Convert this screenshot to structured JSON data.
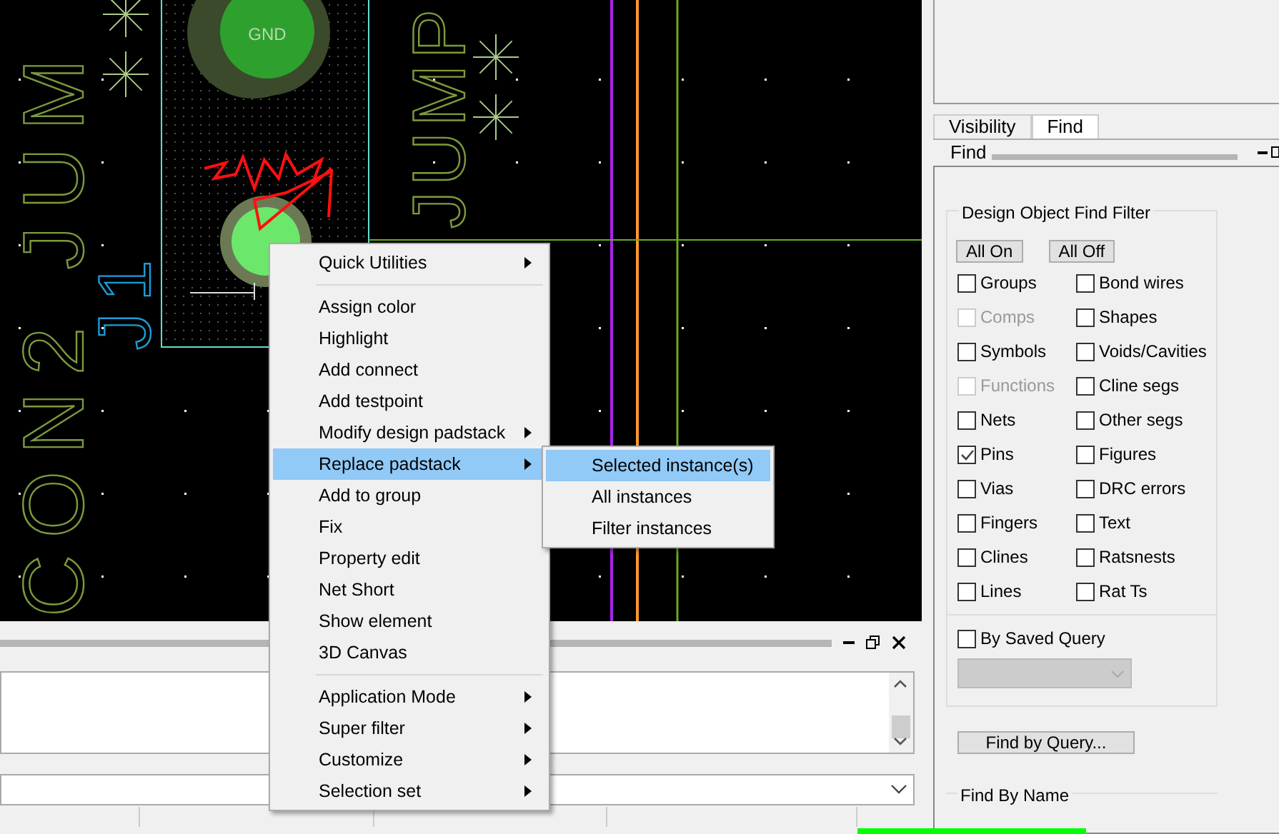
{
  "canvas": {
    "labels": [
      {
        "text": "CON2 JUM",
        "kind": "silk"
      },
      {
        "text": "J1",
        "kind": "refdes"
      },
      {
        "text": "JUMP",
        "kind": "silk"
      }
    ],
    "pad_label": "GND"
  },
  "context_menu": {
    "items": [
      {
        "kind": "item",
        "label": "Quick Utilities",
        "submenu": true,
        "selected": false
      },
      {
        "kind": "separator"
      },
      {
        "kind": "item",
        "label": "Assign color",
        "submenu": false,
        "selected": false
      },
      {
        "kind": "item",
        "label": "Highlight",
        "submenu": false,
        "selected": false
      },
      {
        "kind": "item",
        "label": "Add connect",
        "submenu": false,
        "selected": false
      },
      {
        "kind": "item",
        "label": "Add testpoint",
        "submenu": false,
        "selected": false
      },
      {
        "kind": "item",
        "label": "Modify design padstack",
        "submenu": true,
        "selected": false
      },
      {
        "kind": "item",
        "label": "Replace padstack",
        "submenu": true,
        "selected": true
      },
      {
        "kind": "item",
        "label": "Add to group",
        "submenu": false,
        "selected": false
      },
      {
        "kind": "item",
        "label": "Fix",
        "submenu": false,
        "selected": false
      },
      {
        "kind": "item",
        "label": "Property edit",
        "submenu": false,
        "selected": false
      },
      {
        "kind": "item",
        "label": "Net Short",
        "submenu": false,
        "selected": false
      },
      {
        "kind": "item",
        "label": "Show element",
        "submenu": false,
        "selected": false
      },
      {
        "kind": "item",
        "label": "3D Canvas",
        "submenu": false,
        "selected": false
      },
      {
        "kind": "separator"
      },
      {
        "kind": "item",
        "label": "Application Mode",
        "submenu": true,
        "selected": false
      },
      {
        "kind": "item",
        "label": "Super filter",
        "submenu": true,
        "selected": false
      },
      {
        "kind": "item",
        "label": "Customize",
        "submenu": true,
        "selected": false
      },
      {
        "kind": "item",
        "label": "Selection set",
        "submenu": true,
        "selected": false
      }
    ]
  },
  "submenu": {
    "items": [
      {
        "label": "Selected instance(s)",
        "selected": true
      },
      {
        "label": "All instances",
        "selected": false
      },
      {
        "label": "Filter instances",
        "selected": false
      }
    ]
  },
  "panel": {
    "tabs": [
      {
        "label": "Visibility",
        "selected": false
      },
      {
        "label": "Find",
        "selected": true
      }
    ],
    "header": "Find",
    "group": {
      "title": "Design Object Find Filter",
      "buttons": [
        "All On",
        "All Off"
      ],
      "checkboxes": [
        {
          "label": "Groups",
          "checked": false,
          "disabled": false
        },
        {
          "label": "Bond wires",
          "checked": false,
          "disabled": false
        },
        {
          "label": "Comps",
          "checked": false,
          "disabled": true
        },
        {
          "label": "Shapes",
          "checked": false,
          "disabled": false
        },
        {
          "label": "Symbols",
          "checked": false,
          "disabled": false
        },
        {
          "label": "Voids/Cavities",
          "checked": false,
          "disabled": false
        },
        {
          "label": "Functions",
          "checked": false,
          "disabled": true
        },
        {
          "label": "Cline segs",
          "checked": false,
          "disabled": false
        },
        {
          "label": "Nets",
          "checked": false,
          "disabled": false
        },
        {
          "label": "Other segs",
          "checked": false,
          "disabled": false
        },
        {
          "label": "Pins",
          "checked": true,
          "disabled": false
        },
        {
          "label": "Figures",
          "checked": false,
          "disabled": false
        },
        {
          "label": "Vias",
          "checked": false,
          "disabled": false
        },
        {
          "label": "DRC errors",
          "checked": false,
          "disabled": false
        },
        {
          "label": "Fingers",
          "checked": false,
          "disabled": false
        },
        {
          "label": "Text",
          "checked": false,
          "disabled": false
        },
        {
          "label": "Clines",
          "checked": false,
          "disabled": false
        },
        {
          "label": "Ratsnests",
          "checked": false,
          "disabled": false
        },
        {
          "label": "Lines",
          "checked": false,
          "disabled": false
        },
        {
          "label": "Rat Ts",
          "checked": false,
          "disabled": false
        }
      ],
      "saved_query": {
        "label": "By Saved Query",
        "checked": false
      },
      "query_button": "Find by Query..."
    },
    "find_by_name": "Find By Name"
  }
}
